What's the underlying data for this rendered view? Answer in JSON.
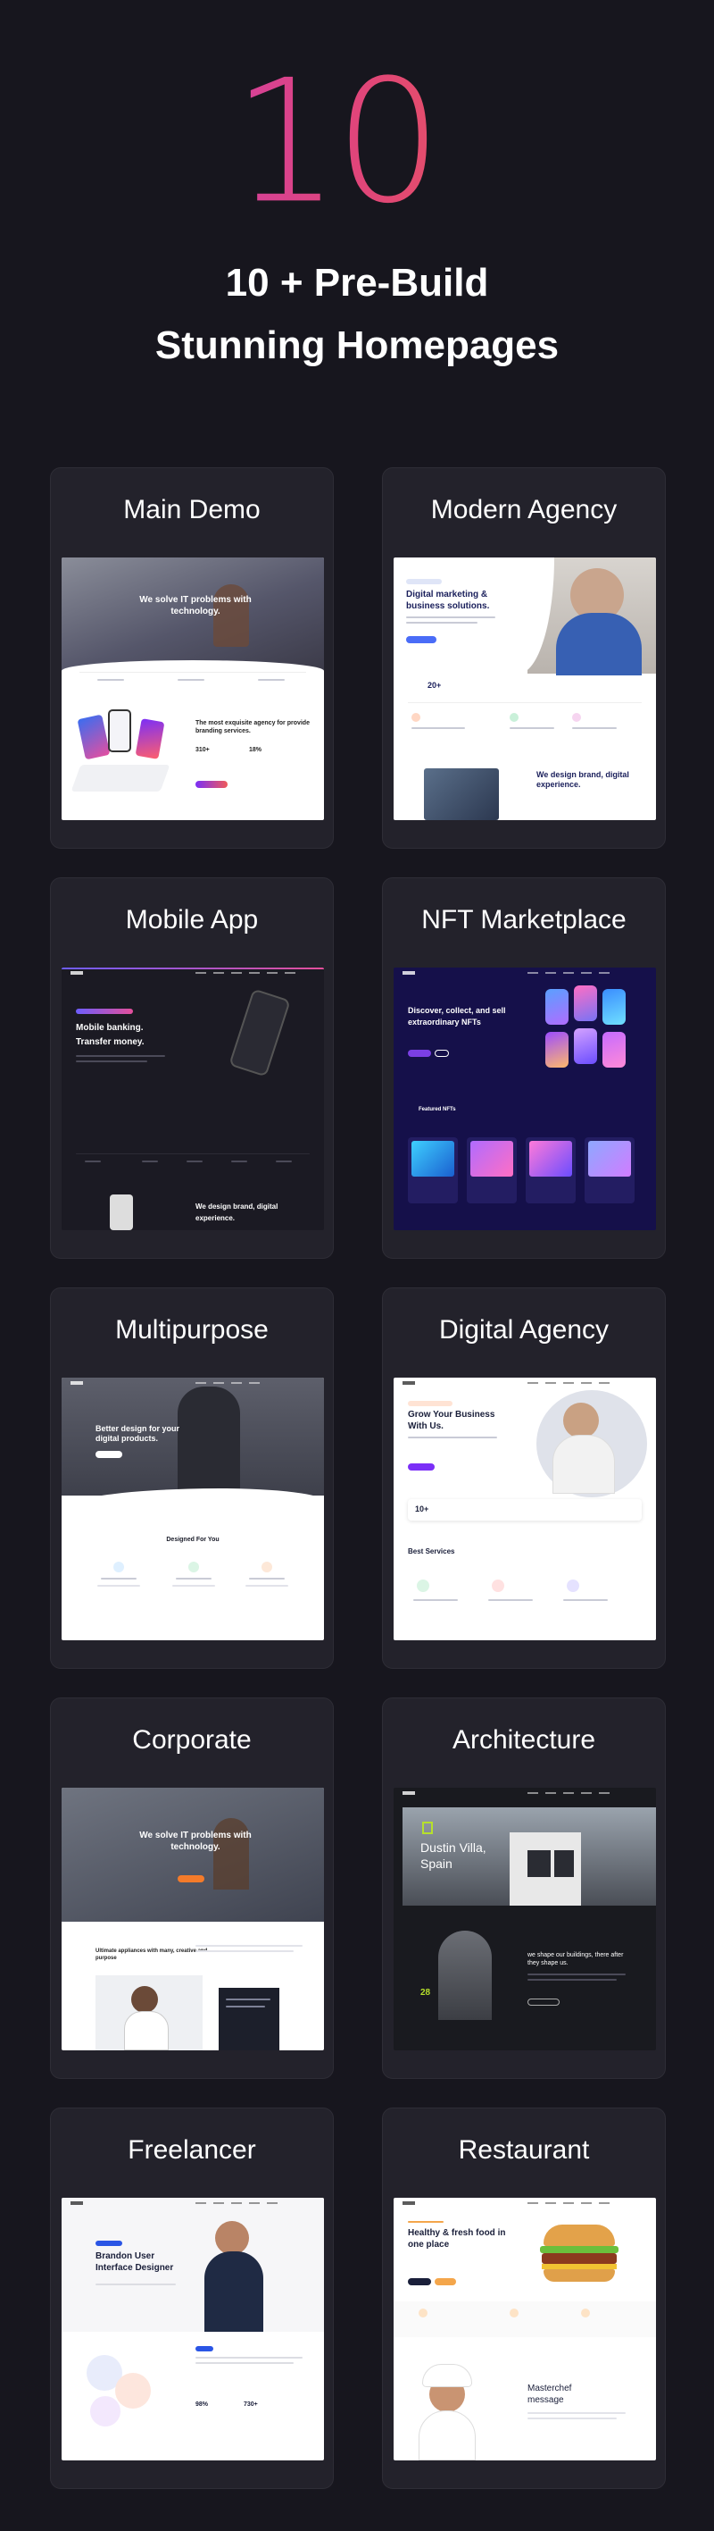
{
  "hero": {
    "big_number": "10",
    "big_number_sup": "+",
    "headline_line1": "10 +  Pre-Build",
    "headline_line2": "Stunning Homepages"
  },
  "demos": [
    {
      "title": "Main Demo"
    },
    {
      "title": "Modern Agency"
    },
    {
      "title": "Mobile App"
    },
    {
      "title": "NFT Marketplace"
    },
    {
      "title": "Multipurpose"
    },
    {
      "title": "Digital Agency"
    },
    {
      "title": "Corporate"
    },
    {
      "title": "Architecture"
    },
    {
      "title": "Freelancer"
    },
    {
      "title": "Restaurant"
    }
  ],
  "previews": {
    "main_demo": {
      "hero_text": "We solve IT problems with technology.",
      "body_title": "The most exquisite agency for provide branding services.",
      "stat1": "310+",
      "stat2": "18%"
    },
    "modern_agency": {
      "hero_text": "Digital marketing & business solutions.",
      "stat": "20+",
      "body_text": "We design brand, digital experience."
    },
    "mobile_app": {
      "hero_text": "Mobile banking. Transfer money.",
      "body_text": "We design brand, digital experience."
    },
    "nft": {
      "hero_text": "Discover, collect, and sell extraordinary NFTs",
      "section": "Featured NFTs"
    },
    "multipurpose": {
      "hero_text": "Better design for your digital products.",
      "section": "Designed For You"
    },
    "digital_agency": {
      "hero_text": "Grow Your Business With Us.",
      "stat": "10+",
      "section": "Best Services"
    },
    "corporate": {
      "hero_text": "We solve IT problems with technology.",
      "body_text": "Ultimate appliances with many, creative and purpose"
    },
    "architecture": {
      "hero_text": "Dustin Villa, Spain",
      "stat": "28",
      "body_text": "we shape our buildings, there after they shape us."
    },
    "freelancer": {
      "hero_text": "Brandon User Interface Designer",
      "stat1": "98%",
      "stat2": "730+"
    },
    "restaurant": {
      "hero_text": "Healthy & fresh food in one place",
      "body_text": "Masterchef message"
    }
  }
}
